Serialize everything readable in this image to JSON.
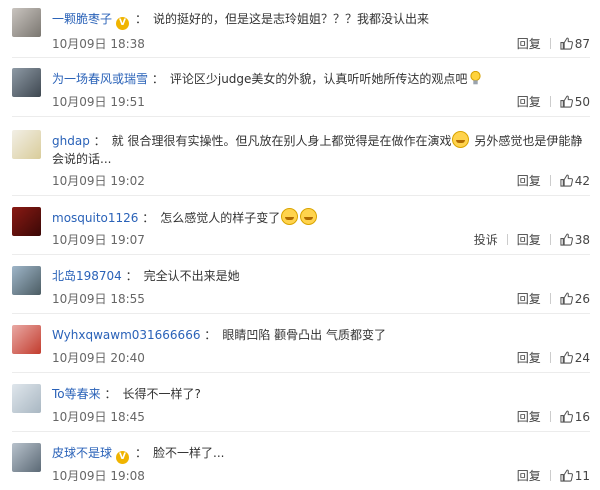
{
  "comments": [
    {
      "user": "一颗脆枣子",
      "verified": true,
      "text": "说的挺好的，但是这是志玲姐姐？？？我都没认出来",
      "emojis": 0,
      "bulb": false,
      "time": "10月09日 18:38",
      "report": "",
      "reply": "回复",
      "likes": "87",
      "avatar": [
        "#c9c4bf",
        "#7a7670"
      ]
    },
    {
      "user": "为一场春风或瑞雪",
      "verified": false,
      "text": "评论区少judge美女的外貌，认真听听她所传达的观点吧",
      "emojis": 0,
      "bulb": true,
      "time": "10月09日 19:51",
      "report": "",
      "reply": "回复",
      "likes": "50",
      "avatar": [
        "#8e9aa5",
        "#3e4750"
      ]
    },
    {
      "user": "ghdap",
      "verified": false,
      "text": "就 很合理很有实操性。但凡放在别人身上都觉得是在做作在演戏",
      "text2": "另外感觉也是伊能静会说的话...",
      "emojis": 1,
      "bulb": false,
      "time": "10月09日 19:02",
      "report": "",
      "reply": "回复",
      "likes": "42",
      "avatar": [
        "#f2efe6",
        "#d9cc9a"
      ]
    },
    {
      "user": "mosquito1126",
      "verified": false,
      "text": "怎么感觉人的样子变了",
      "emojis": 2,
      "bulb": false,
      "time": "10月09日 19:07",
      "report": "投诉",
      "reply": "回复",
      "likes": "38",
      "avatar": [
        "#8a1a14",
        "#3a0806"
      ]
    },
    {
      "user": "北岛198704",
      "verified": false,
      "text": "完全认不出来是她",
      "emojis": 0,
      "bulb": false,
      "time": "10月09日 18:55",
      "report": "",
      "reply": "回复",
      "likes": "26",
      "avatar": [
        "#9fb6c9",
        "#4b5c63"
      ]
    },
    {
      "user": "Wyhxqwawm031666666",
      "verified": false,
      "text": "眼睛凹陷 颧骨凸出 气质都变了",
      "emojis": 0,
      "bulb": false,
      "time": "10月09日 20:40",
      "report": "",
      "reply": "回复",
      "likes": "24",
      "avatar": [
        "#e9a9a4",
        "#c23c2e"
      ]
    },
    {
      "user": "To等春来",
      "verified": false,
      "text": "长得不一样了?",
      "emojis": 0,
      "bulb": false,
      "time": "10月09日 18:45",
      "report": "",
      "reply": "回复",
      "likes": "16",
      "avatar": [
        "#dfe6ec",
        "#a9b7c2"
      ]
    },
    {
      "user": "皮球不是球",
      "verified": true,
      "text": "脸不一样了...",
      "emojis": 0,
      "bulb": false,
      "time": "10月09日 19:08",
      "report": "",
      "reply": "回复",
      "likes": "11",
      "avatar": [
        "#b8c2cc",
        "#5b6975"
      ]
    }
  ]
}
